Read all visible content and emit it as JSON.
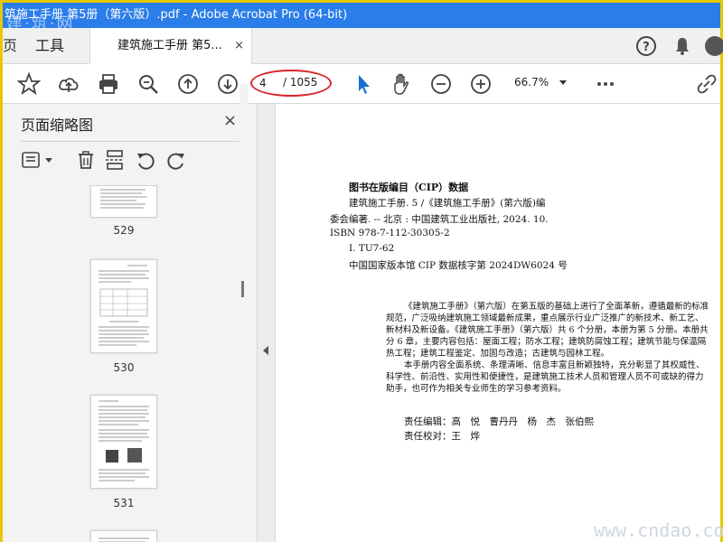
{
  "window": {
    "title": "筑施工手册 第5册（第六版）.pdf - Adobe Acrobat Pro (64-bit)",
    "watermark": "建·筑·网"
  },
  "tabs": {
    "home": "页",
    "tools": "工具",
    "document": "建筑施工手册 第5...",
    "close": "×"
  },
  "toolbar": {
    "current_page": "4",
    "total_pages": "/ 1055",
    "zoom": "66.7%"
  },
  "left_panel": {
    "title": "页面缩略图",
    "close": "×",
    "thumbnails": [
      {
        "label": "529"
      },
      {
        "label": "530"
      },
      {
        "label": "531"
      }
    ]
  },
  "document": {
    "cip_title": "图书在版编目（CIP）数据",
    "cip_lines": [
      "建筑施工手册. 5 /《建筑施工手册》(第六版)编",
      "委会编著. -- 北京 : 中国建筑工业出版社, 2024. 10.",
      "ISBN 978-7-112-30305-2",
      "Ⅰ. TU7-62",
      "中国国家版本馆 CIP 数据核字第 2024DW6024 号"
    ],
    "paragraph": [
      "《建筑施工手册》（第六版）在第五版的基础上进行了全面革新，遵循最新的标准",
      "规范，广泛吸纳建筑施工领域最新成果，重点展示行业广泛推广的新技术、新工艺、",
      "新材料及新设备。《建筑施工手册》（第六版）共 6 个分册，本册为第 5 分册。本册共",
      "分 6 章，主要内容包括：屋面工程；防水工程；建筑防腐蚀工程；建筑节能与保温隔",
      "热工程；建筑工程鉴定、加固与改造；古建筑与园林工程。",
      "本手册内容全面系统、条理清晰、信息丰富且新颖独特，充分彰显了其权威性、",
      "科学性、前沿性、实用性和便捷性，是建筑施工技术人员和管理人员不可或缺的得力",
      "助手，也可作为相关专业师生的学习参考资料。"
    ],
    "editor": "责任编辑：高　悦　曹丹丹　杨　杰　张伯熙",
    "proofreader": "责任校对：王　烨"
  },
  "site_watermark": "www.cndao.com",
  "colors": {
    "titlebar": "#2b7de9",
    "highlight_ring": "#d8262a",
    "cursor_blue": "#1a6fd6"
  }
}
